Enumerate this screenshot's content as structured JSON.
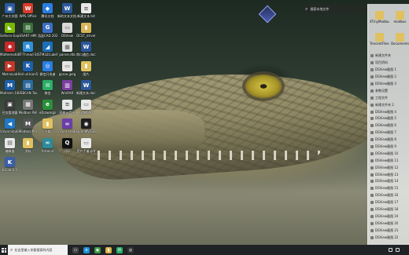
{
  "desktop": {
    "search": {
      "placeholder": "搜索本地文件",
      "icon": "search-icon"
    },
    "icons": [
      {
        "label": "广州大学图",
        "color": "#2c5aa0",
        "glyph": "▣"
      },
      {
        "label": "WPS Office",
        "color": "#d93b2c",
        "glyph": "W"
      },
      {
        "label": "腾讯文档",
        "color": "#2a7de1",
        "glyph": "◆"
      },
      {
        "label": "新的文本文档.docx",
        "color": "#2b579a",
        "glyph": "W"
      },
      {
        "label": "新建文本.txt",
        "color": "#e8e8e8",
        "glyph": "≡"
      },
      {
        "label": "Geforce Experience",
        "color": "#76b900",
        "glyph": "◣"
      },
      {
        "label": "USART HMI",
        "color": "#3c6e3c",
        "glyph": "▤"
      },
      {
        "label": "浩辰CAD 2020",
        "color": "#3a6fc4",
        "glyph": "G"
      },
      {
        "label": "DSView",
        "color": "#d9d9d9",
        "glyph": "▭"
      },
      {
        "label": "DCST_driver",
        "color": "#d9b55a",
        "glyph": "▮"
      },
      {
        "label": "Mathematica",
        "color": "#c62828",
        "glyph": "✱"
      },
      {
        "label": "RT-Thread Studio",
        "color": "#2f8fd8",
        "glyph": "R"
      },
      {
        "label": "STM32CubeMX",
        "color": "#1b6fb8",
        "glyph": "◢"
      },
      {
        "label": "parser.dta",
        "color": "#e0e0e0",
        "glyph": "▦"
      },
      {
        "label": "串口通信.docx",
        "color": "#2b579a",
        "glyph": "W"
      },
      {
        "label": "MatrixLab",
        "color": "#c0392b",
        "glyph": "▶"
      },
      {
        "label": "Keil uVision5",
        "color": "#1f5fa8",
        "glyph": "K"
      },
      {
        "label": "微信开发者",
        "color": "#2a7de1",
        "glyph": "◎"
      },
      {
        "label": "pproe.jpeg",
        "color": "#e6e6e6",
        "glyph": "▭"
      },
      {
        "label": "图片",
        "color": "#e0c060",
        "glyph": "▮"
      },
      {
        "label": "Multisim 14.0",
        "color": "#1d5fa8",
        "glyph": "M"
      },
      {
        "label": "USBCAN Tool",
        "color": "#2c6a9e",
        "glyph": "▤"
      },
      {
        "label": "微信",
        "color": "#2aae67",
        "glyph": "✉"
      },
      {
        "label": "WinRAR",
        "color": "#7b3fa0",
        "glyph": "▥"
      },
      {
        "label": "新建文本.docx",
        "color": "#2b579a",
        "glyph": "W"
      },
      {
        "label": "任务管理器",
        "color": "#3b3b3b",
        "glyph": "▣"
      },
      {
        "label": "Modbus Poll",
        "color": "#777777",
        "glyph": "▦"
      },
      {
        "label": "eDrawings",
        "color": "#2a8f3a",
        "glyph": "e"
      },
      {
        "label": "网易云音乐",
        "color": "#e8e8e8",
        "glyph": "≡"
      },
      {
        "label": "FreeCAD",
        "color": "#e8e8e8",
        "glyph": "▭"
      },
      {
        "label": "Visual Studio Code",
        "color": "#1f77c9",
        "glyph": "◀"
      },
      {
        "label": "Modbus Pro",
        "color": "#555555",
        "glyph": "M"
      },
      {
        "label": "下载",
        "color": "#e0c060",
        "glyph": "▮"
      },
      {
        "label": "Visual Studio",
        "color": "#6a3fa8",
        "glyph": "∞"
      },
      {
        "label": "OpenMV IDE",
        "color": "#1e1e1e",
        "glyph": "◉"
      },
      {
        "label": "编辑器",
        "color": "#e8e8e8",
        "glyph": "▤"
      },
      {
        "label": "资料",
        "color": "#e0c060",
        "glyph": "▮"
      },
      {
        "label": "Arduino",
        "color": "#2e8b9a",
        "glyph": "∞"
      },
      {
        "label": "QQ",
        "color": "#111111",
        "glyph": "Q"
      },
      {
        "label": "用户手册.pdf",
        "color": "#e8e8e8",
        "glyph": "▭"
      },
      {
        "label": "KiCad 6.0",
        "color": "#3a5fa8",
        "glyph": "K"
      }
    ],
    "right_panel": {
      "icons": [
        {
          "label": "XTinyModbus",
          "color": "#e0c060"
        },
        {
          "label": "modbus",
          "color": "#e0c060"
        },
        {
          "label": "TencentFiles",
          "color": "#e0c060"
        },
        {
          "label": "Documents",
          "color": "#e0c060"
        }
      ],
      "items": [
        "新建文件夹",
        "项目资料",
        "DSView截图 1",
        "DSView截图 2",
        "DSView截图 3",
        "参数设置",
        "工程文件",
        "新建文件夹 2",
        "DSView截图 4",
        "DSView截图 5",
        "DSView截图 6",
        "DSView截图 7",
        "DSView截图 8",
        "DSView截图 9",
        "DSView截图 10",
        "DSView截图 11",
        "DSView截图 12",
        "DSView截图 13",
        "DSView截图 14",
        "DSView截图 15",
        "DSView截图 16",
        "DSView截图 17",
        "DSView截图 18",
        "DSView截图 19",
        "DSView截图 20",
        "DSView截图 21",
        "DSView截图 22"
      ]
    }
  },
  "taskbar": {
    "search_placeholder": "在这里输入你要搜索的内容",
    "apps": [
      {
        "name": "task-view-icon",
        "color": "#444",
        "glyph": "▭"
      },
      {
        "name": "edge-icon",
        "color": "#1f8fd8",
        "glyph": "e"
      },
      {
        "name": "chrome-icon",
        "color": "#3a9b46",
        "glyph": "◉"
      },
      {
        "name": "folder-icon",
        "color": "#d9b24a",
        "glyph": "▮"
      },
      {
        "name": "wechat-icon",
        "color": "#2aae67",
        "glyph": "✉"
      },
      {
        "name": "obs-icon",
        "color": "#333",
        "glyph": "◎"
      }
    ],
    "tray": {
      "clock": "",
      "date": ""
    }
  }
}
